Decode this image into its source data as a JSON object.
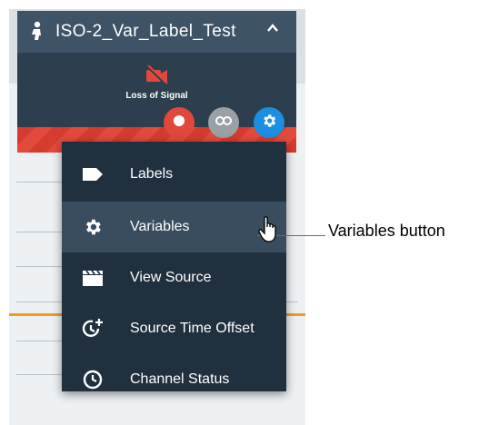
{
  "card": {
    "title": "ISO-2_Var_Label_Test",
    "status_text": "Loss of Signal",
    "header_icon": "person-icon",
    "collapse_icon": "chevron-up-icon"
  },
  "actions": [
    {
      "name": "record-button",
      "icon": "record-icon",
      "color": "#e0483b"
    },
    {
      "name": "link-button",
      "icon": "link-icon",
      "color": "#9aa0a6"
    },
    {
      "name": "settings-button",
      "icon": "gear-icon",
      "color": "#1a8fe3"
    }
  ],
  "menu": {
    "items": [
      {
        "label": "Labels",
        "icon": "label-icon"
      },
      {
        "label": "Variables",
        "icon": "gear-icon"
      },
      {
        "label": "View Source",
        "icon": "clapperboard-icon"
      },
      {
        "label": "Source Time Offset",
        "icon": "clock-plus-icon"
      },
      {
        "label": "Channel Status",
        "icon": "clock-icon"
      }
    ],
    "active_index": 1
  },
  "callout": {
    "text": "Variables button"
  },
  "colors": {
    "accent_orange": "#f59a1b",
    "alert_red": "#e0483b",
    "menu_bg": "#20303f"
  }
}
